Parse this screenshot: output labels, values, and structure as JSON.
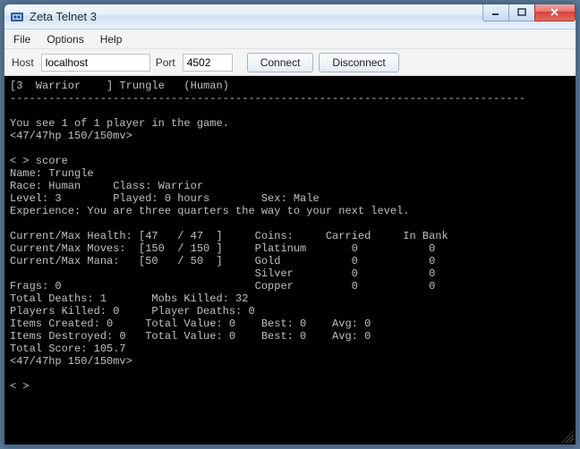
{
  "window": {
    "title": "Zeta Telnet 3"
  },
  "menu": {
    "file": "File",
    "options": "Options",
    "help": "Help"
  },
  "conn": {
    "host_label": "Host",
    "host_value": "localhost",
    "port_label": "Port",
    "port_value": "4502",
    "connect": "Connect",
    "disconnect": "Disconnect"
  },
  "term": {
    "header": "[3  Warrior    ] Trungle   (Human)",
    "divider": "--------------------------------------------------------------------------------",
    "see": "You see 1 of 1 player in the game.",
    "prompt1": "<47/47hp 150/150mv>",
    "cmd": "< > score",
    "name": "Name: Trungle",
    "raceclass": "Race: Human     Class: Warrior",
    "lvl": "Level: 3        Played: 0 hours        Sex: Male",
    "exp": "Experience: You are three quarters the way to your next level.",
    "hp": "Current/Max Health: [47   / 47  ]     Coins:     Carried     In Bank",
    "mv": "Current/Max Moves:  [150  / 150 ]     Platinum       0           0",
    "mana": "Current/Max Mana:   [50   / 50  ]     Gold           0           0",
    "silver": "                                      Silver         0           0",
    "frags": "Frags: 0                              Copper         0           0",
    "deaths": "Total Deaths: 1       Mobs Killed: 32",
    "pk": "Players Killed: 0     Player Deaths: 0",
    "created": "Items Created: 0     Total Value: 0    Best: 0    Avg: 0",
    "destroyed": "Items Destroyed: 0   Total Value: 0    Best: 0    Avg: 0",
    "score": "Total Score: 105.7",
    "prompt2": "<47/47hp 150/150mv>",
    "prompt3": "< >"
  }
}
